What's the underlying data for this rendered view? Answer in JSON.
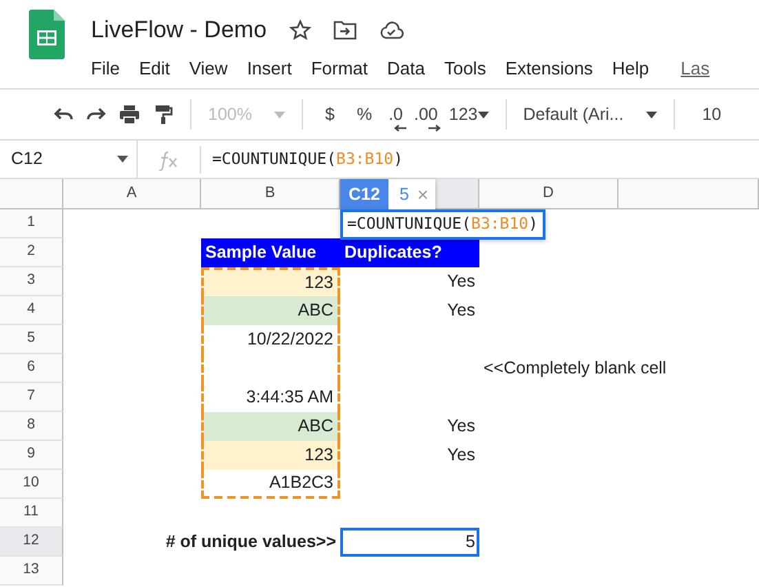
{
  "document": {
    "title": "LiveFlow - Demo",
    "menu": [
      "File",
      "Edit",
      "View",
      "Insert",
      "Format",
      "Data",
      "Tools",
      "Extensions",
      "Help"
    ],
    "last_edit_link": "Las"
  },
  "toolbar": {
    "zoom": {
      "text": "100%",
      "disabled": true
    },
    "currency": "$",
    "percent": "%",
    "decrease_decimals": ".0",
    "increase_decimals": ".00",
    "number_format": "123",
    "font": "Default (Ari...",
    "font_size": "10"
  },
  "formula_bar": {
    "cell": "C12",
    "formula": {
      "before": "=COUNTUNIQUE(",
      "range": "B3:B10",
      "after": ")"
    }
  },
  "columns": [
    {
      "label": "A",
      "selected": false
    },
    {
      "label": "B",
      "selected": false
    },
    {
      "selected": true
    },
    {
      "label": "D",
      "selected": false
    },
    {
      "selected": false
    }
  ],
  "cell_tooltip": {
    "cell": "C12",
    "value": "5",
    "close": "×"
  },
  "cell_editor": {
    "before": "=COUNTUNIQUE(",
    "range": "B3:B10",
    "after": ")"
  },
  "rows": [
    {
      "number": "1",
      "selected": false
    },
    {
      "number": "2",
      "selected": false,
      "b": {
        "text": "Sample Value",
        "kind": "header"
      },
      "c": {
        "text": "Duplicates?",
        "kind": "header"
      }
    },
    {
      "number": "3",
      "selected": false,
      "b": {
        "text": "123",
        "kind": "value",
        "color": "#fff2cc",
        "outlined": true
      },
      "c": {
        "text": "Yes",
        "kind": "value"
      }
    },
    {
      "number": "4",
      "selected": false,
      "b": {
        "text": "ABC",
        "kind": "value",
        "color": "#d9ead3",
        "outlined": true
      },
      "c": {
        "text": "Yes",
        "kind": "value"
      }
    },
    {
      "number": "5",
      "selected": false,
      "b": {
        "text": "10/22/2022",
        "kind": "value",
        "outlined": true
      }
    },
    {
      "number": "6",
      "selected": false,
      "b": {
        "kind": "value",
        "outlined": true
      },
      "d": {
        "text": "<<Completely blank cell",
        "kind": "note"
      }
    },
    {
      "number": "7",
      "selected": false,
      "b": {
        "text": "3:44:35 AM",
        "kind": "value",
        "outlined": true
      }
    },
    {
      "number": "8",
      "selected": false,
      "b": {
        "text": "ABC",
        "kind": "value",
        "color": "#d9ead3",
        "outlined": true
      },
      "c": {
        "text": "Yes",
        "kind": "value"
      }
    },
    {
      "number": "9",
      "selected": false,
      "b": {
        "text": "123",
        "kind": "value",
        "color": "#fff2cc",
        "outlined": true
      },
      "c": {
        "text": "Yes",
        "kind": "value"
      }
    },
    {
      "number": "10",
      "selected": false,
      "b": {
        "text": "A1B2C3",
        "kind": "value",
        "outlined": true
      }
    },
    {
      "number": "11",
      "selected": false
    },
    {
      "number": "12",
      "selected": true,
      "b": {
        "text": "# of unique values>>",
        "kind": "label"
      },
      "c": {
        "text": "5",
        "kind": "value",
        "selected": true
      }
    },
    {
      "number": "13",
      "selected": false
    }
  ]
}
